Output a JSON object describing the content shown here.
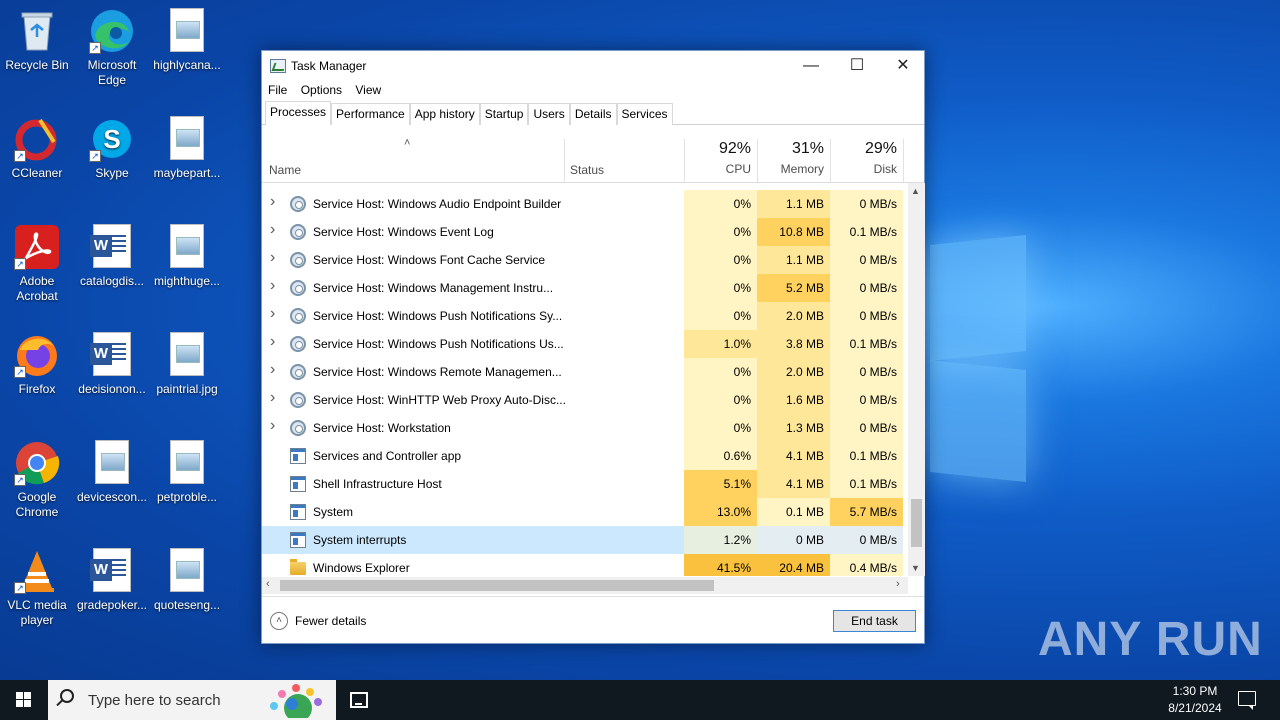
{
  "desktop": {
    "icons": [
      {
        "label": "Recycle Bin",
        "icon": "recycle-bin-icon"
      },
      {
        "label": "Microsoft Edge",
        "icon": "edge-icon"
      },
      {
        "label": "highlycana...",
        "icon": "image-file-icon"
      },
      {
        "label": "CCleaner",
        "icon": "ccleaner-icon"
      },
      {
        "label": "Skype",
        "icon": "skype-icon"
      },
      {
        "label": "maybepart...",
        "icon": "image-file-icon"
      },
      {
        "label": "Adobe Acrobat",
        "icon": "acrobat-icon"
      },
      {
        "label": "catalogdis...",
        "icon": "word-doc-icon"
      },
      {
        "label": "mighthuge...",
        "icon": "image-file-icon"
      },
      {
        "label": "Firefox",
        "icon": "firefox-icon"
      },
      {
        "label": "decisionon...",
        "icon": "word-doc-icon"
      },
      {
        "label": "paintrial.jpg",
        "icon": "image-file-icon"
      },
      {
        "label": "Google Chrome",
        "icon": "chrome-icon"
      },
      {
        "label": "devicescon...",
        "icon": "image-file-icon"
      },
      {
        "label": "petproble...",
        "icon": "image-file-icon"
      },
      {
        "label": "VLC media player",
        "icon": "vlc-icon"
      },
      {
        "label": "gradepoker...",
        "icon": "word-doc-icon"
      },
      {
        "label": "quoteseng...",
        "icon": "image-file-icon"
      }
    ],
    "watermark": "ANY RUN"
  },
  "window": {
    "title": "Task Manager",
    "menu": [
      "File",
      "Options",
      "View"
    ],
    "tabs": [
      "Processes",
      "Performance",
      "App history",
      "Startup",
      "Users",
      "Details",
      "Services"
    ],
    "active_tab": "Processes",
    "columns": {
      "name": "Name",
      "status": "Status",
      "cpu": {
        "percent": "92%",
        "label": "CPU"
      },
      "memory": {
        "percent": "31%",
        "label": "Memory"
      },
      "disk": {
        "percent": "29%",
        "label": "Disk"
      }
    },
    "rows": [
      {
        "name": "Service Host: Windows Audio Endpoint Builder",
        "status": "",
        "cpu": "0%",
        "memory": "1.1 MB",
        "disk": "0 MB/s",
        "icon": "gear-icon",
        "expandable": true
      },
      {
        "name": "Service Host: Windows Event Log",
        "status": "",
        "cpu": "0%",
        "memory": "10.8 MB",
        "disk": "0.1 MB/s",
        "icon": "gear-icon",
        "expandable": true
      },
      {
        "name": "Service Host: Windows Font Cache Service",
        "status": "",
        "cpu": "0%",
        "memory": "1.1 MB",
        "disk": "0 MB/s",
        "icon": "gear-icon",
        "expandable": true
      },
      {
        "name": "Service Host: Windows Management Instru...",
        "status": "",
        "cpu": "0%",
        "memory": "5.2 MB",
        "disk": "0 MB/s",
        "icon": "gear-icon",
        "expandable": true
      },
      {
        "name": "Service Host: Windows Push Notifications Sy...",
        "status": "",
        "cpu": "0%",
        "memory": "2.0 MB",
        "disk": "0 MB/s",
        "icon": "gear-icon",
        "expandable": true
      },
      {
        "name": "Service Host: Windows Push Notifications Us...",
        "status": "",
        "cpu": "1.0%",
        "memory": "3.8 MB",
        "disk": "0.1 MB/s",
        "icon": "gear-icon",
        "expandable": true
      },
      {
        "name": "Service Host: Windows Remote Managemen...",
        "status": "",
        "cpu": "0%",
        "memory": "2.0 MB",
        "disk": "0 MB/s",
        "icon": "gear-icon",
        "expandable": true
      },
      {
        "name": "Service Host: WinHTTP Web Proxy Auto-Disc...",
        "status": "",
        "cpu": "0%",
        "memory": "1.6 MB",
        "disk": "0 MB/s",
        "icon": "gear-icon",
        "expandable": true
      },
      {
        "name": "Service Host: Workstation",
        "status": "",
        "cpu": "0%",
        "memory": "1.3 MB",
        "disk": "0 MB/s",
        "icon": "gear-icon",
        "expandable": true
      },
      {
        "name": "Services and Controller app",
        "status": "",
        "cpu": "0.6%",
        "memory": "4.1 MB",
        "disk": "0.1 MB/s",
        "icon": "app-window-icon",
        "expandable": false
      },
      {
        "name": "Shell Infrastructure Host",
        "status": "",
        "cpu": "5.1%",
        "memory": "4.1 MB",
        "disk": "0.1 MB/s",
        "icon": "app-window-icon",
        "expandable": false
      },
      {
        "name": "System",
        "status": "",
        "cpu": "13.0%",
        "memory": "0.1 MB",
        "disk": "5.7 MB/s",
        "icon": "app-window-icon",
        "expandable": false
      },
      {
        "name": "System interrupts",
        "status": "",
        "cpu": "1.2%",
        "memory": "0 MB",
        "disk": "0 MB/s",
        "icon": "app-window-icon",
        "expandable": false,
        "selected": true
      },
      {
        "name": "Windows Explorer",
        "status": "",
        "cpu": "41.5%",
        "memory": "20.4 MB",
        "disk": "0.4 MB/s",
        "icon": "folder-icon",
        "expandable": false
      }
    ],
    "fewer_details": "Fewer details",
    "end_task": "End task"
  },
  "taskbar": {
    "search_placeholder": "Type here to search",
    "time": "1:30 PM",
    "date": "8/21/2024"
  },
  "colors": {
    "heat_low": "#fff4c4",
    "heat_mid": "#ffe79a",
    "heat_high": "#ffd25f",
    "heat_max": "#f9c13e",
    "selection": "#cce8ff",
    "accent": "#0078d7"
  }
}
